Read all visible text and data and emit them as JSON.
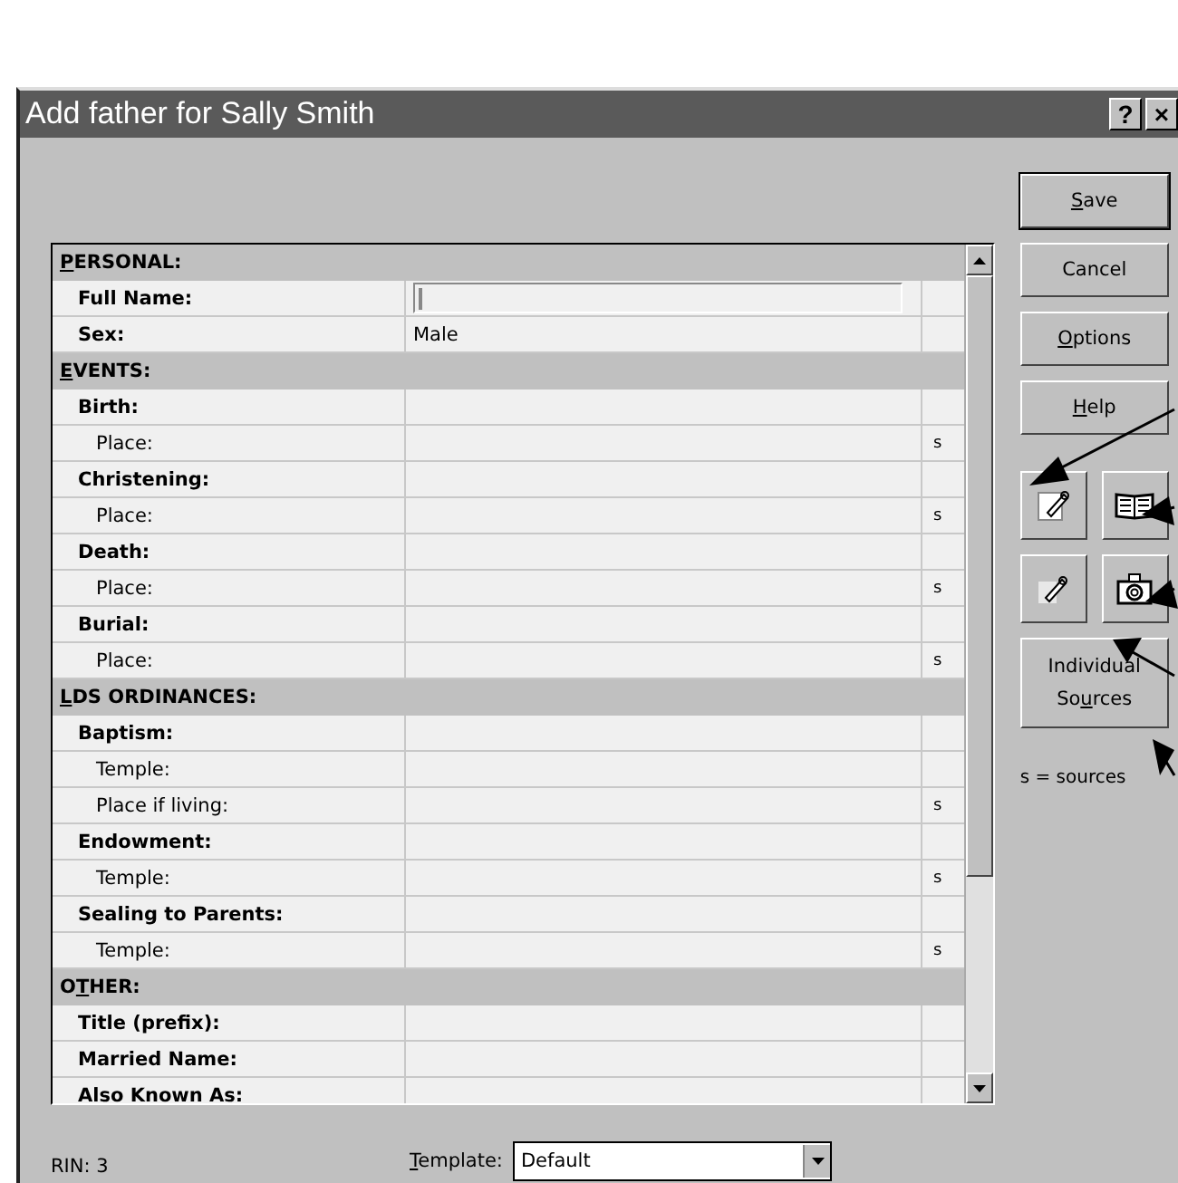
{
  "window": {
    "title": "Add father for Sally Smith",
    "title_buttons": [
      "?",
      "×"
    ]
  },
  "grid": {
    "rows": [
      {
        "kind": "section",
        "label": {
          "key": "P",
          "post": "ERSONAL:"
        }
      },
      {
        "kind": "input",
        "label": "Full Name:"
      },
      {
        "kind": "field",
        "label": "Sex:",
        "value": "Male"
      },
      {
        "kind": "section",
        "label": {
          "key": "E",
          "post": "VENTS:"
        }
      },
      {
        "kind": "field",
        "label": "Birth:"
      },
      {
        "kind": "subfield",
        "label": "Place:",
        "sources": "s"
      },
      {
        "kind": "field",
        "label": "Christening:"
      },
      {
        "kind": "subfield",
        "label": "Place:",
        "sources": "s"
      },
      {
        "kind": "field",
        "label": "Death:"
      },
      {
        "kind": "subfield",
        "label": "Place:",
        "sources": "s"
      },
      {
        "kind": "field",
        "label": "Burial:"
      },
      {
        "kind": "subfield",
        "label": "Place:",
        "sources": "s"
      },
      {
        "kind": "section",
        "label": {
          "key": "L",
          "post": "DS ORDINANCES:"
        }
      },
      {
        "kind": "field",
        "label": "Baptism:"
      },
      {
        "kind": "subfield",
        "label": "Temple:"
      },
      {
        "kind": "subfield",
        "label": "Place if living:",
        "sources": "s"
      },
      {
        "kind": "field",
        "label": "Endowment:"
      },
      {
        "kind": "subfield",
        "label": "Temple:",
        "sources": "s"
      },
      {
        "kind": "field",
        "label": "Sealing to Parents:"
      },
      {
        "kind": "subfield",
        "label": "Temple:",
        "sources": "s"
      },
      {
        "kind": "section",
        "label": {
          "pre": "O",
          "key": "T",
          "post": "HER:"
        }
      },
      {
        "kind": "field",
        "label": "Title (prefix):"
      },
      {
        "kind": "field",
        "label": "Married Name:"
      },
      {
        "kind": "field",
        "label": "Also Known As:"
      }
    ]
  },
  "buttons": [
    {
      "label": {
        "key": "S",
        "post": "ave"
      },
      "default": true
    },
    {
      "label": {
        "pre": "Cancel"
      },
      "default": false
    },
    {
      "label": {
        "key": "O",
        "post": "ptions"
      },
      "default": false
    },
    {
      "label": {
        "key": "H",
        "post": "elp"
      },
      "default": false
    }
  ],
  "icon_buttons": [
    {
      "kind": "notes"
    },
    {
      "kind": "book"
    },
    {
      "kind": "edit"
    },
    {
      "kind": "camera"
    }
  ],
  "sources_button": {
    "line1": "Individual",
    "line2": {
      "pre": "So",
      "key": "u",
      "post": "rces"
    }
  },
  "legend": "s = sources",
  "status": {
    "rin": "RIN: 3",
    "template_label": {
      "key": "T",
      "post": "emplate:"
    },
    "template_value": "Default"
  }
}
